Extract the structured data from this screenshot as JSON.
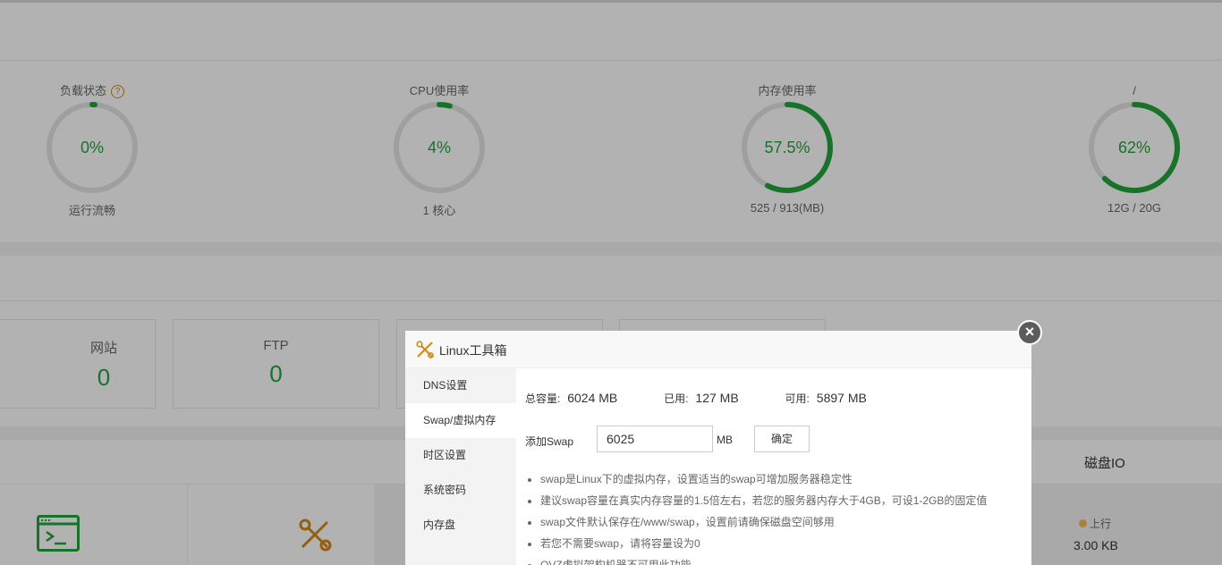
{
  "gauges": [
    {
      "title": "负载状态",
      "pct": "0%",
      "value": 0,
      "sub": "运行流畅",
      "help": "?"
    },
    {
      "title": "CPU使用率",
      "pct": "4%",
      "value": 4,
      "sub": "1 核心"
    },
    {
      "title": "内存使用率",
      "pct": "57.5%",
      "value": 57.5,
      "sub": "525 / 913(MB)"
    },
    {
      "title": "/",
      "pct": "62%",
      "value": 62,
      "sub": "12G / 20G"
    }
  ],
  "stats": [
    {
      "label": "网站",
      "value": "0"
    },
    {
      "label": "FTP",
      "value": "0"
    }
  ],
  "dialog": {
    "title": "Linux工具箱",
    "close": "×",
    "tabs": [
      "DNS设置",
      "Swap/虚拟内存",
      "时区设置",
      "系统密码",
      "内存盘"
    ],
    "capacity": {
      "total_label": "总容量:",
      "total": "6024 MB",
      "used_label": "已用:",
      "used": "127 MB",
      "free_label": "可用:",
      "free": "5897 MB"
    },
    "add": {
      "label": "添加Swap",
      "value": "6025",
      "unit": "MB",
      "button": "确定"
    },
    "tips": [
      "swap是Linux下的虚拟内存，设置适当的swap可增加服务器稳定性",
      "建议swap容量在真实内存容量的1.5倍左右，若您的服务器内存大于4GB，可设1-2GB的固定值",
      "swap文件默认保存在/www/swap，设置前请确保磁盘空间够用",
      "若您不需要swap，请将容量设为0",
      "OVZ虚拟架构机器不可用此功能"
    ]
  },
  "io": {
    "title": "磁盘IO",
    "up_label": "上行",
    "up_value": "3.00 KB"
  },
  "colors": {
    "accent": "#20a53a",
    "track": "#e4e4e4",
    "warn": "#d4880f"
  }
}
